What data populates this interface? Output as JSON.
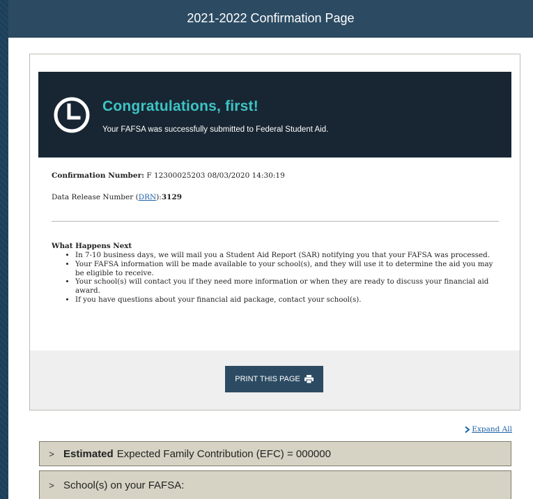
{
  "header": {
    "title": "2021-2022 Confirmation Page"
  },
  "banner": {
    "title": "Congratulations, first!",
    "subtitle": "Your FAFSA was successfully submitted to Federal Student Aid."
  },
  "confirmation": {
    "label": "Confirmation Number:",
    "value": "F 12300025203 08/03/2020 14:30:19"
  },
  "drn": {
    "prefix": "Data Release Number (",
    "link": "DRN",
    "suffix": "):",
    "value": "3129"
  },
  "what_next": {
    "title": "What Happens Next",
    "items": [
      "In 7-10 business days, we will mail you a Student Aid Report (SAR) notifying you that your FAFSA was processed.",
      "Your FAFSA information will be made available to your school(s), and they will use it to determine the aid you may be eligible to receive.",
      "Your school(s) will contact you if they need more information or when they are ready to discuss your financial aid award.",
      "If you have questions about your financial aid package, contact your school(s)."
    ]
  },
  "print": {
    "label": "PRINT THIS PAGE",
    "icon": "printer-icon"
  },
  "expand_all": {
    "label": "Expand All"
  },
  "accordion": [
    {
      "bold": "Estimated",
      "text": "Expected Family Contribution (EFC) = 000000"
    },
    {
      "bold": "",
      "text": "School(s) on your FAFSA:"
    }
  ],
  "colors": {
    "header": "#2c4b63",
    "banner": "#182633",
    "accent": "#3ec4c4",
    "link": "#1c63a8"
  }
}
